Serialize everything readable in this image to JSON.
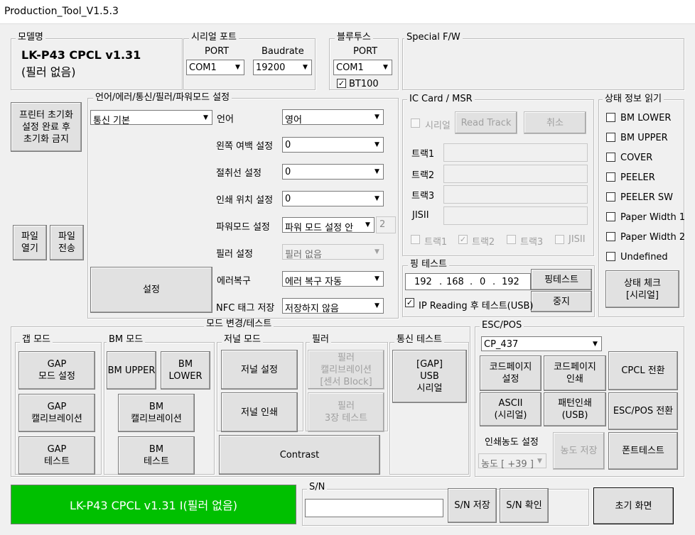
{
  "title": "Production_Tool_V1.5.3",
  "model": {
    "label": "모델명",
    "line1": "LK-P43 CPCL v1.31",
    "line2": "(필러 없음)"
  },
  "serial": {
    "label": "시리얼 포트",
    "port_label": "PORT",
    "baud_label": "Baudrate",
    "port": "COM1",
    "baud": "19200"
  },
  "bluetooth": {
    "label": "블루투스",
    "port_label": "PORT",
    "port": "COM1",
    "bt100": "BT100",
    "bt100_checked": "✓"
  },
  "special": {
    "label": "Special F/W"
  },
  "left": {
    "init_btn": "프린터 초기화\n설정 완료 후\n초기화 금지",
    "file_open": "파일\n열기",
    "file_send": "파일\n전송"
  },
  "settings": {
    "label": "언어/에러/통신/필러/파워모드 설정",
    "comm_combo": "통신 기본",
    "set_btn": "설정",
    "rows": [
      {
        "label": "언어",
        "value": "영어"
      },
      {
        "label": "왼쪽 여백 설정",
        "value": "0"
      },
      {
        "label": "절취선 설정",
        "value": "0"
      },
      {
        "label": "인쇄 위치 설정",
        "value": "0"
      },
      {
        "label": "파워모드 설정",
        "value": "파워 모드 설정 안"
      },
      {
        "label": "필러 설정",
        "value": "필러 없음"
      },
      {
        "label": "에러복구",
        "value": "에러 복구 자동"
      },
      {
        "label": "NFC 태그 저장",
        "value": "저장하지 않음"
      }
    ],
    "power_extra": "2"
  },
  "ic": {
    "label": "IC Card / MSR",
    "serial": "시리얼",
    "read_track": "Read Track",
    "cancel": "취소",
    "tracks": [
      "트랙1",
      "트랙2",
      "트랙3",
      "JISII"
    ],
    "checks": [
      "트랙1",
      "트랙2",
      "트랙3",
      "JISII"
    ],
    "check2_mark": "✓"
  },
  "status": {
    "label": "상태 정보 읽기",
    "items": [
      "BM LOWER",
      "BM UPPER",
      "COVER",
      "PEELER",
      "PEELER SW",
      "Paper Width 1",
      "Paper Width 2",
      "Undefined"
    ],
    "check_btn": "상태 체크\n[시리얼]"
  },
  "ping": {
    "label": "핑 테스트",
    "ip": [
      "192",
      "168",
      "0",
      "192"
    ],
    "ping_btn": "핑테스트",
    "stop_btn": "중지",
    "ip_reading": "IP Reading 후 테스트(USB)",
    "ip_reading_mark": "✓"
  },
  "mode": {
    "label": "모드 변경/테스트",
    "gap": {
      "label": "갭 모드",
      "b1": "GAP\n모드 설정",
      "b2": "GAP\n캘리브레이션",
      "b3": "GAP\n테스트"
    },
    "bm": {
      "label": "BM 모드",
      "upper": "BM UPPER",
      "lower": "BM LOWER",
      "cal": "BM\n캘리브레이션",
      "test": "BM\n테스트"
    },
    "journal": {
      "label": "저널 모드",
      "set": "저널 설정",
      "print": "저널 인쇄"
    },
    "peeler": {
      "label": "필러",
      "cal": "필러\n캘리브레이션\n[센서 Block]",
      "test": "필러\n3장 테스트"
    },
    "comm": {
      "label": "통신 테스트",
      "btn": "[GAP]\nUSB\n시리얼"
    },
    "contrast": "Contrast"
  },
  "esc": {
    "label": "ESC/POS",
    "combo": "CP_437",
    "cp_set": "코드페이지\n설정",
    "cp_print": "코드페이지\n인쇄",
    "cpcl": "CPCL 전환",
    "ascii": "ASCII\n(시리얼)",
    "pattern": "패턴인쇄\n(USB)",
    "escpos": "ESC/POS 전환",
    "density_label": "인쇄농도 설정",
    "density": "농도 [ +39 ]",
    "density_save": "농도 저장",
    "font_test": "폰트테스트"
  },
  "banner": {
    "text": "LK-P43 CPCL v1.31 I(필러 없음)",
    "color": "#00c000"
  },
  "sn": {
    "label": "S/N",
    "value": "",
    "save": "S/N 저장",
    "check": "S/N 확인"
  },
  "home_btn": "초기 화면"
}
